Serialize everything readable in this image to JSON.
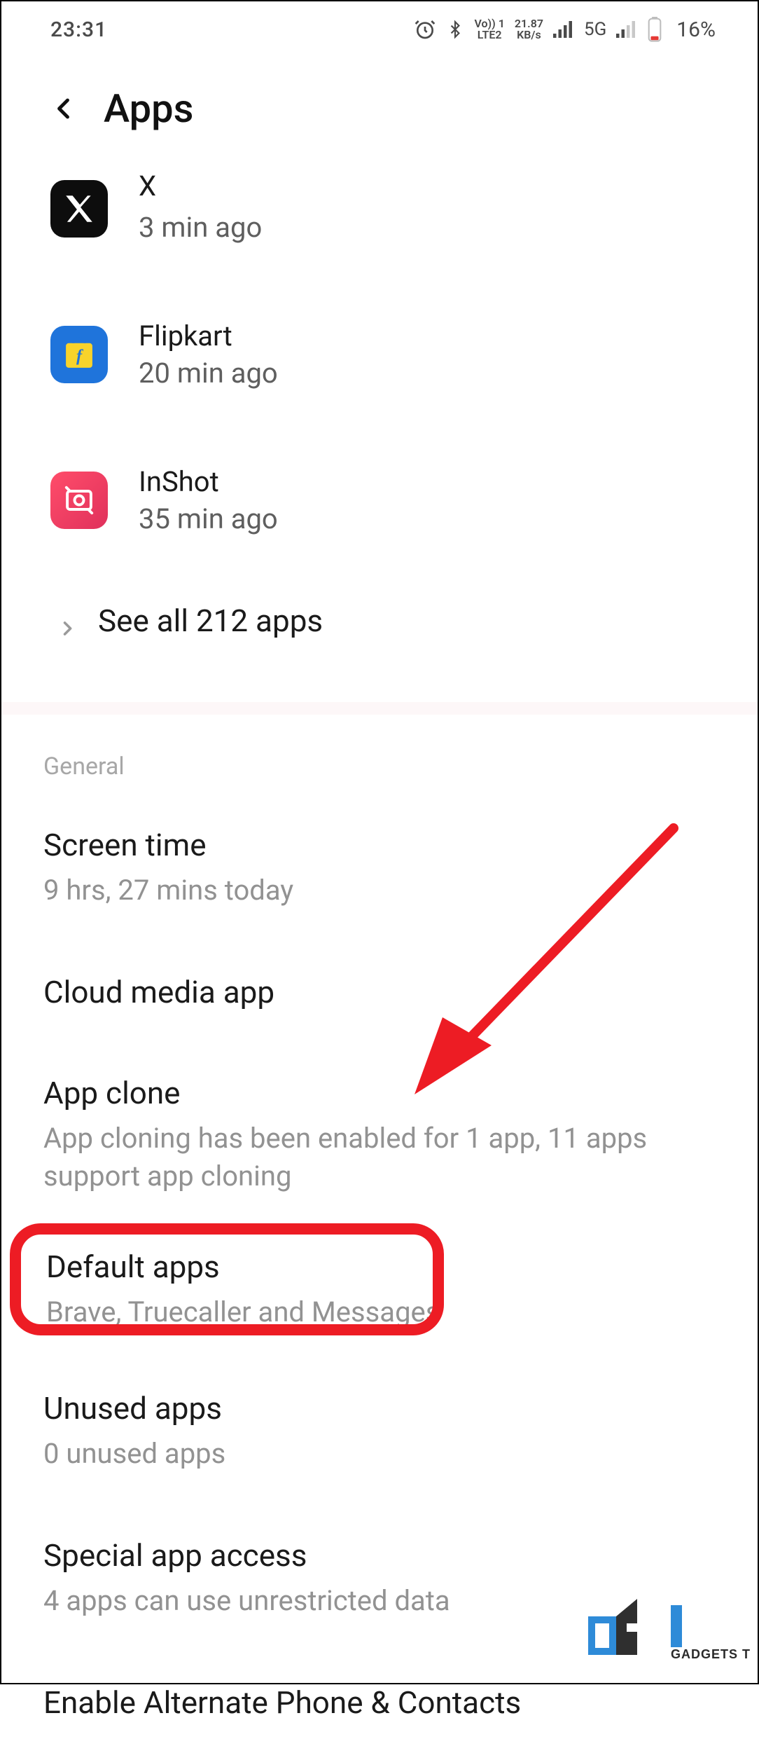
{
  "statusbar": {
    "time": "23:31",
    "net_line1": "Vo)) 1",
    "net_line2": "LTE2",
    "speed_line1": "21.87",
    "speed_line2": "KB/s",
    "network_label": "5G",
    "battery_pct": "16%"
  },
  "header": {
    "title": "Apps"
  },
  "recent": [
    {
      "name": "X",
      "sub": "3 min ago",
      "icon": "x"
    },
    {
      "name": "Flipkart",
      "sub": "20 min ago",
      "icon": "flipkart"
    },
    {
      "name": "InShot",
      "sub": "35 min ago",
      "icon": "inshot"
    }
  ],
  "see_all": "See all 212 apps",
  "section_label": "General",
  "settings": {
    "screen_time": {
      "title": "Screen time",
      "desc": "9 hrs, 27 mins today"
    },
    "cloud_media": {
      "title": "Cloud media app"
    },
    "app_clone": {
      "title": "App clone",
      "desc": "App cloning has been enabled for 1 app, 11 apps support app cloning"
    },
    "default_apps": {
      "title": "Default apps",
      "desc": "Brave, Truecaller and Messages"
    },
    "unused_apps": {
      "title": "Unused apps",
      "desc": "0 unused apps"
    },
    "special_access": {
      "title": "Special app access",
      "desc": "4 apps can use unrestricted data"
    },
    "alt_phone": {
      "title": "Enable Alternate Phone & Contacts"
    }
  },
  "watermark": "GADGETS T",
  "annotation": {
    "highlight_target": "default-apps-item",
    "highlight_color": "#ed1c24"
  }
}
